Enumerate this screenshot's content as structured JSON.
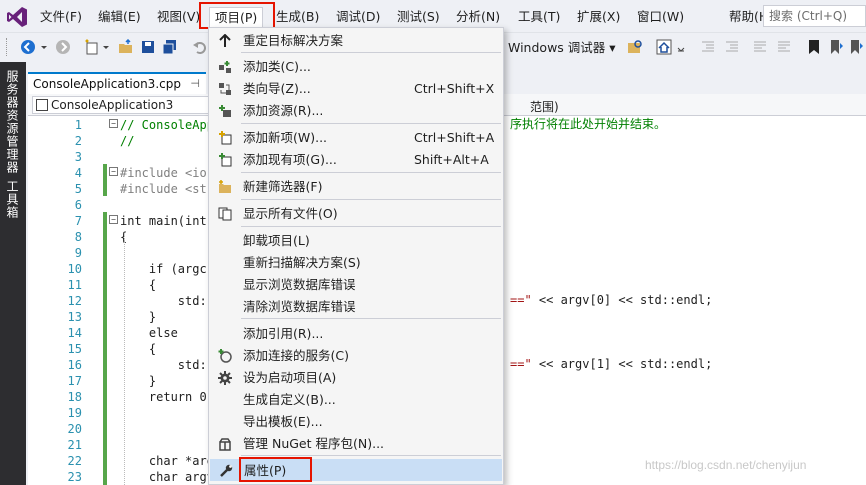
{
  "menubar": {
    "items": [
      "文件(F)",
      "编辑(E)",
      "视图(V)",
      "项目(P)",
      "生成(B)",
      "调试(D)",
      "测试(S)",
      "分析(N)",
      "工具(T)",
      "扩展(X)",
      "窗口(W)",
      "帮助(H)"
    ],
    "search_placeholder": "搜索 (Ctrl+Q)"
  },
  "toolbar": {
    "debug_target": "Windows 调试器 ▾"
  },
  "left_panel": {
    "server_explorer": "服务器资源管理器",
    "toolbox": "工具箱"
  },
  "document": {
    "tab_title": "ConsoleApplication3.cpp",
    "tab_pin": "⊣",
    "nav_project": "ConsoleApplication3",
    "nav_scope": "范围)"
  },
  "editor": {
    "line_numbers": [
      "1",
      "2",
      "3",
      "4",
      "5",
      "6",
      "7",
      "8",
      "9",
      "10",
      "11",
      "12",
      "13",
      "14",
      "15",
      "16",
      "17",
      "18",
      "19",
      "20",
      "21",
      "22",
      "23"
    ],
    "lines": [
      {
        "t": "// ConsoleApp",
        "c": "cm"
      },
      {
        "t": "//",
        "c": "cm"
      },
      {
        "t": "",
        "c": ""
      },
      {
        "t": "#include <ios",
        "c": "pp"
      },
      {
        "t": "#include <str",
        "c": "pp"
      },
      {
        "t": "",
        "c": ""
      },
      {
        "t": "int main(int",
        "c": ""
      },
      {
        "t": "{",
        "c": ""
      },
      {
        "t": "",
        "c": ""
      },
      {
        "t": "    if (argc",
        "c": ""
      },
      {
        "t": "    {",
        "c": ""
      },
      {
        "t": "        std::",
        "c": ""
      },
      {
        "t": "    }",
        "c": ""
      },
      {
        "t": "    else",
        "c": ""
      },
      {
        "t": "    {",
        "c": ""
      },
      {
        "t": "        std::",
        "c": ""
      },
      {
        "t": "    }",
        "c": ""
      },
      {
        "t": "    return 0",
        "c": ""
      },
      {
        "t": "",
        "c": ""
      },
      {
        "t": "",
        "c": ""
      },
      {
        "t": "",
        "c": ""
      },
      {
        "t": "    char *arg",
        "c": ""
      },
      {
        "t": "    char argv",
        "c": ""
      }
    ],
    "right_fragments": {
      "line1": "序执行将在此处开始并结束。",
      "line12_str": "==\"",
      "line12_rest": " << argv[0] << std::endl;",
      "line16_str": "==\"",
      "line16_rest": " << argv[1] << std::endl;"
    }
  },
  "project_menu": {
    "items": [
      {
        "icon": "arrow-up-icon",
        "label": "重定目标解决方案",
        "shortcut": ""
      },
      {
        "icon": "add-class-icon",
        "label": "添加类(C)...",
        "shortcut": ""
      },
      {
        "icon": "class-wizard-icon",
        "label": "类向导(Z)...",
        "shortcut": "Ctrl+Shift+X"
      },
      {
        "icon": "add-resource-icon",
        "label": "添加资源(R)...",
        "shortcut": ""
      },
      {
        "icon": "add-new-item-icon",
        "label": "添加新项(W)...",
        "shortcut": "Ctrl+Shift+A"
      },
      {
        "icon": "add-existing-item-icon",
        "label": "添加现有项(G)...",
        "shortcut": "Shift+Alt+A"
      },
      {
        "icon": "new-filter-icon",
        "label": "新建筛选器(F)",
        "shortcut": ""
      },
      {
        "icon": "show-all-files-icon",
        "label": "显示所有文件(O)",
        "shortcut": ""
      },
      {
        "icon": "",
        "label": "卸载项目(L)",
        "shortcut": ""
      },
      {
        "icon": "",
        "label": "重新扫描解决方案(S)",
        "shortcut": ""
      },
      {
        "icon": "",
        "label": "显示浏览数据库错误",
        "shortcut": ""
      },
      {
        "icon": "",
        "label": "清除浏览数据库错误",
        "shortcut": ""
      },
      {
        "icon": "",
        "label": "添加引用(R)...",
        "shortcut": ""
      },
      {
        "icon": "connected-service-icon",
        "label": "添加连接的服务(C)",
        "shortcut": ""
      },
      {
        "icon": "gear-icon",
        "label": "设为启动项目(A)",
        "shortcut": ""
      },
      {
        "icon": "",
        "label": "生成自定义(B)...",
        "shortcut": ""
      },
      {
        "icon": "",
        "label": "导出模板(E)...",
        "shortcut": ""
      },
      {
        "icon": "nuget-icon",
        "label": "管理 NuGet 程序包(N)...",
        "shortcut": ""
      },
      {
        "icon": "wrench-icon",
        "label": "属性(P)",
        "shortcut": ""
      }
    ]
  },
  "watermark": "https://blog.csdn.net/chenyijun",
  "colors": {
    "accent": "#007acc",
    "highlight": "#c9def5",
    "callout": "#e51400",
    "vs_purple": "#68217a"
  }
}
